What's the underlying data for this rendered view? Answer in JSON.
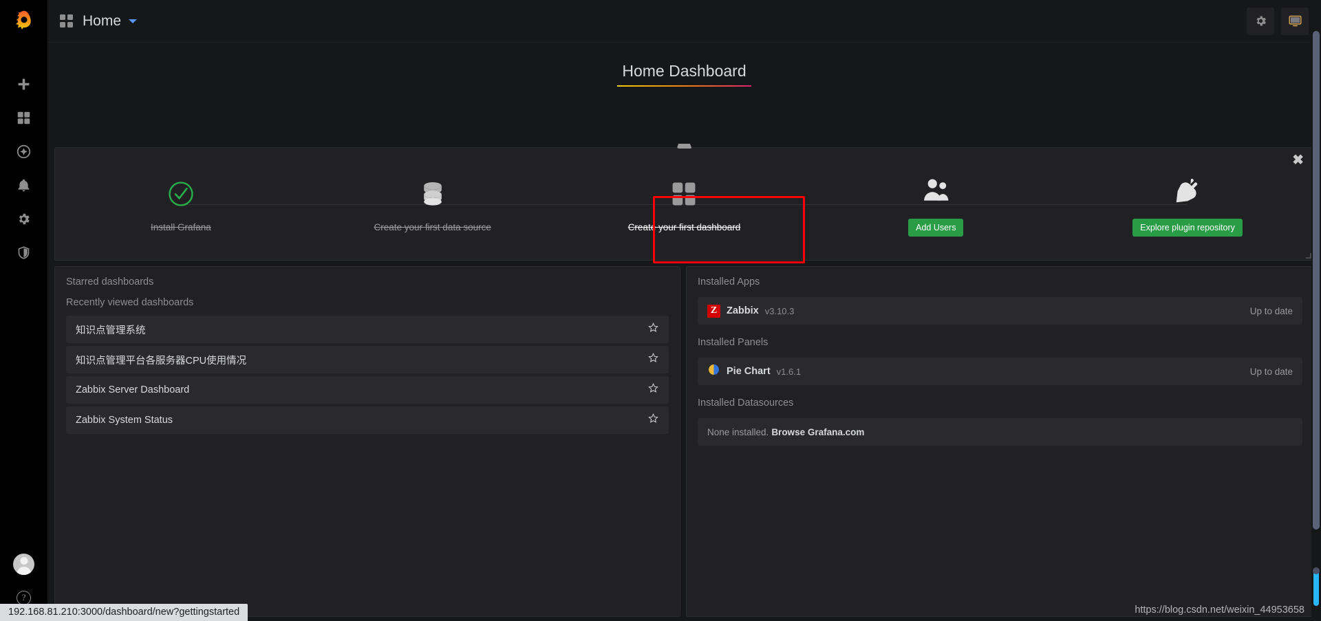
{
  "sidebar": {
    "brand_icon": "grafana-logo",
    "items": [
      {
        "icon": "plus-icon",
        "label": "Create"
      },
      {
        "icon": "grid-icon",
        "label": "Dashboards"
      },
      {
        "icon": "compass-icon",
        "label": "Explore"
      },
      {
        "icon": "bell-icon",
        "label": "Alerting"
      },
      {
        "icon": "gear-icon",
        "label": "Configuration"
      },
      {
        "icon": "shield-icon",
        "label": "Server Admin"
      }
    ],
    "bottom": [
      {
        "icon": "avatar-icon",
        "label": "User profile"
      },
      {
        "icon": "help-icon",
        "label": "Help"
      }
    ]
  },
  "navbar": {
    "grid_icon": "dashboard-grid-icon",
    "title": "Home",
    "caret_icon": "chevron-down-icon",
    "actions": [
      {
        "icon": "gear-icon",
        "label": "Dashboard settings"
      },
      {
        "icon": "tv-icon",
        "label": "Cycle view mode"
      }
    ]
  },
  "dashboard": {
    "title": "Home Dashboard"
  },
  "getting_started": {
    "close_icon": "close-icon",
    "steps": [
      {
        "icon": "check-circle-icon",
        "label": "Install Grafana",
        "done": true,
        "type": "text",
        "highlighted": false
      },
      {
        "icon": "database-icon",
        "label": "Create your first data source",
        "done": true,
        "type": "text",
        "highlighted": false
      },
      {
        "icon": "grid-icon",
        "label": "Create your first dashboard",
        "done": true,
        "type": "text",
        "highlighted": true
      },
      {
        "icon": "users-icon",
        "label": "Add Users",
        "done": false,
        "type": "button",
        "highlighted": false
      },
      {
        "icon": "plug-icon",
        "label": "Explore plugin repository",
        "done": false,
        "type": "button",
        "highlighted": false
      }
    ]
  },
  "starred_panel": {
    "starred_heading": "Starred dashboards",
    "recent_heading": "Recently viewed dashboards",
    "recent_dashboards": [
      {
        "name": "知识点管理系统",
        "star_icon": "star-outline-icon"
      },
      {
        "name": "知识点管理平台各服务器CPU使用情况",
        "star_icon": "star-outline-icon"
      },
      {
        "name": "Zabbix Server Dashboard",
        "star_icon": "star-outline-icon"
      },
      {
        "name": "Zabbix System Status",
        "star_icon": "star-outline-icon"
      }
    ]
  },
  "plugins_panel": {
    "apps_heading": "Installed Apps",
    "apps": [
      {
        "badge": "Z",
        "name": "Zabbix",
        "version": "v3.10.3",
        "status": "Up to date",
        "icon": "zabbix-icon"
      }
    ],
    "panels_heading": "Installed Panels",
    "panels": [
      {
        "name": "Pie Chart",
        "version": "v1.6.1",
        "status": "Up to date",
        "icon": "pie-chart-icon"
      }
    ],
    "datasources_heading": "Installed Datasources",
    "datasources_empty_text": "None installed.",
    "datasources_link": "Browse Grafana.com"
  },
  "status_bar": {
    "url": "192.168.81.210:3000/dashboard/new?gettingstarted"
  },
  "watermark": {
    "text": "https://blog.csdn.net/weixin_44953658"
  },
  "colors": {
    "page_bg": "#161719",
    "panel_bg": "#212124",
    "accent_green": "#299c46",
    "annotation_red": "#fb0000",
    "link_blue": "#5794f2",
    "zabbix_red": "#d40000"
  }
}
